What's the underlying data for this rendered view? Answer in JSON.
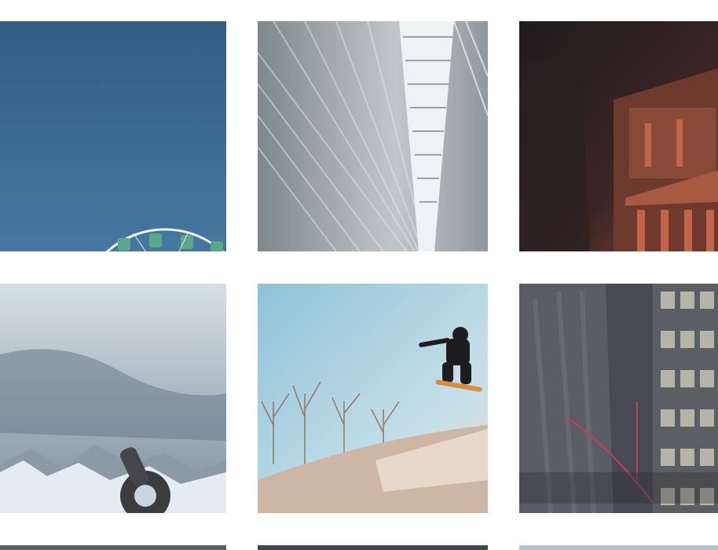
{
  "gallery": {
    "rows": [
      {
        "items": [
          {
            "subject": "ferris-wheel",
            "colors": {
              "sky": "#3e6a92",
              "wheel": "#f2f2f2",
              "cabin": "#5aa88a"
            }
          },
          {
            "subject": "white-architecture",
            "colors": {
              "base": "#9aa3a6",
              "light": "#eef2f3",
              "dark": "#6e7a80"
            }
          },
          {
            "subject": "petra-treasury-night",
            "colors": {
              "sky": "#1d1a1c",
              "rock": "#7a3f33",
              "glow": "#c2634a"
            }
          }
        ]
      },
      {
        "items": [
          {
            "subject": "snowy-mountains",
            "colors": {
              "sky": "#c9d6df",
              "cloud": "#7d8d9b",
              "snow": "#e6edf2"
            }
          },
          {
            "subject": "skateboarder-jump",
            "colors": {
              "sky": "#a9cfe0",
              "ramp": "#cdb7a4",
              "trees": "#9a6b4c"
            }
          },
          {
            "subject": "city-building-pipes",
            "colors": {
              "wall": "#4a4c55",
              "accent": "#c2414a",
              "window": "#b6b4a8"
            }
          }
        ]
      },
      {
        "items": [
          {
            "subject": "partial-image",
            "colors": {
              "base": "#5a5e63"
            }
          },
          {
            "subject": "partial-image",
            "colors": {
              "base": "#3f4448"
            }
          },
          {
            "subject": "partial-image",
            "colors": {
              "base": "#b7c1c8"
            }
          }
        ]
      }
    ]
  }
}
